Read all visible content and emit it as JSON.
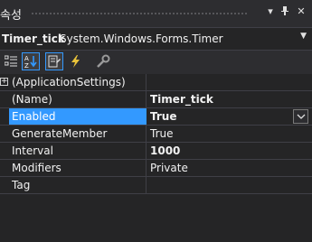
{
  "titlebar": {
    "title": "속성",
    "icons": [
      "dropdown-icon",
      "pin-icon",
      "close-icon"
    ]
  },
  "object": {
    "name": "Timer_tick",
    "type": "System.Windows.Forms.Timer"
  },
  "toolbar": {
    "icons": [
      "categorized-icon",
      "alphabetical-icon",
      "properties-icon",
      "events-icon",
      "property-pages-icon"
    ]
  },
  "grid": {
    "rows": [
      {
        "name": "(ApplicationSettings)",
        "value": ""
      },
      {
        "name": "(Name)",
        "value": "Timer_tick"
      },
      {
        "name": "Enabled",
        "value": "True"
      },
      {
        "name": "GenerateMember",
        "value": "True"
      },
      {
        "name": "Interval",
        "value": "1000"
      },
      {
        "name": "Modifiers",
        "value": "Private"
      },
      {
        "name": "Tag",
        "value": ""
      }
    ],
    "expander": "+"
  },
  "colors": {
    "background": "#252526",
    "selection": "#3399ff",
    "accent_border": "#3399ff",
    "text": "#f1f1f1"
  }
}
